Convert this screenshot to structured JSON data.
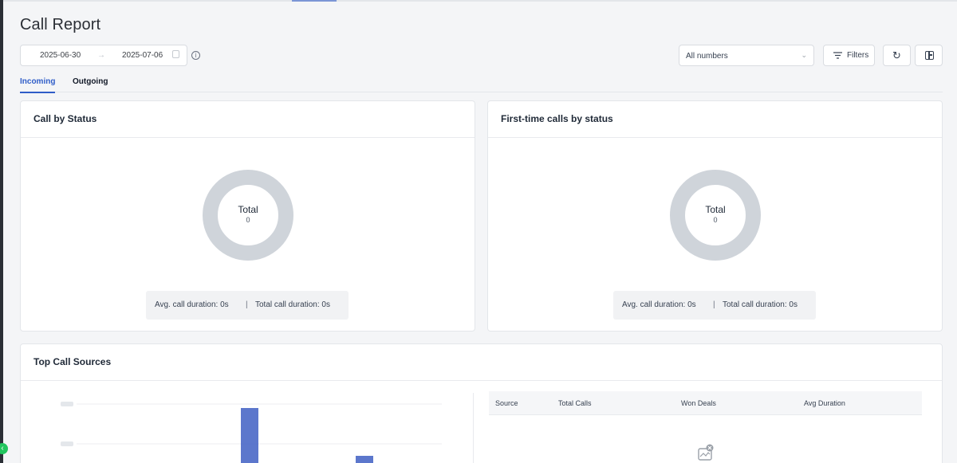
{
  "page": {
    "title": "Call Report"
  },
  "toolbar": {
    "date_start": "2025-06-30",
    "date_arrow": "→",
    "date_end": "2025-07-06",
    "numbers_select": "All numbers",
    "filters_label": "Filters",
    "refresh_glyph": "↻"
  },
  "tabs": [
    {
      "label": "Incoming",
      "active": true
    },
    {
      "label": "Outgoing",
      "active": false
    }
  ],
  "cards": {
    "by_status": {
      "title": "Call by Status",
      "total_label": "Total",
      "total_value": "0",
      "avg_duration": "Avg. call duration: 0s",
      "separator": "|",
      "total_duration": "Total call duration: 0s"
    },
    "first_time": {
      "title": "First-time calls by status",
      "total_label": "Total",
      "total_value": "0",
      "avg_duration": "Avg. call duration: 0s",
      "separator": "|",
      "total_duration": "Total call duration: 0s"
    },
    "top_sources": {
      "title": "Top Call Sources",
      "columns": [
        "Source",
        "Total Calls",
        "Won Deals",
        "Avg Duration"
      ]
    }
  },
  "colors": {
    "accent": "#2f5dc8",
    "donut_empty": "#cfd4da",
    "bar": "#4a68c7"
  },
  "icons": {
    "calendar": "calendar-icon",
    "info": "info-icon",
    "filter": "filter-icon",
    "refresh": "refresh-icon",
    "layout": "layout-icon",
    "empty": "empty-state-icon"
  },
  "chart_data": {
    "type": "bar",
    "values": [
      200,
      80
    ],
    "ylim": [
      0,
      230
    ],
    "grid": true
  }
}
